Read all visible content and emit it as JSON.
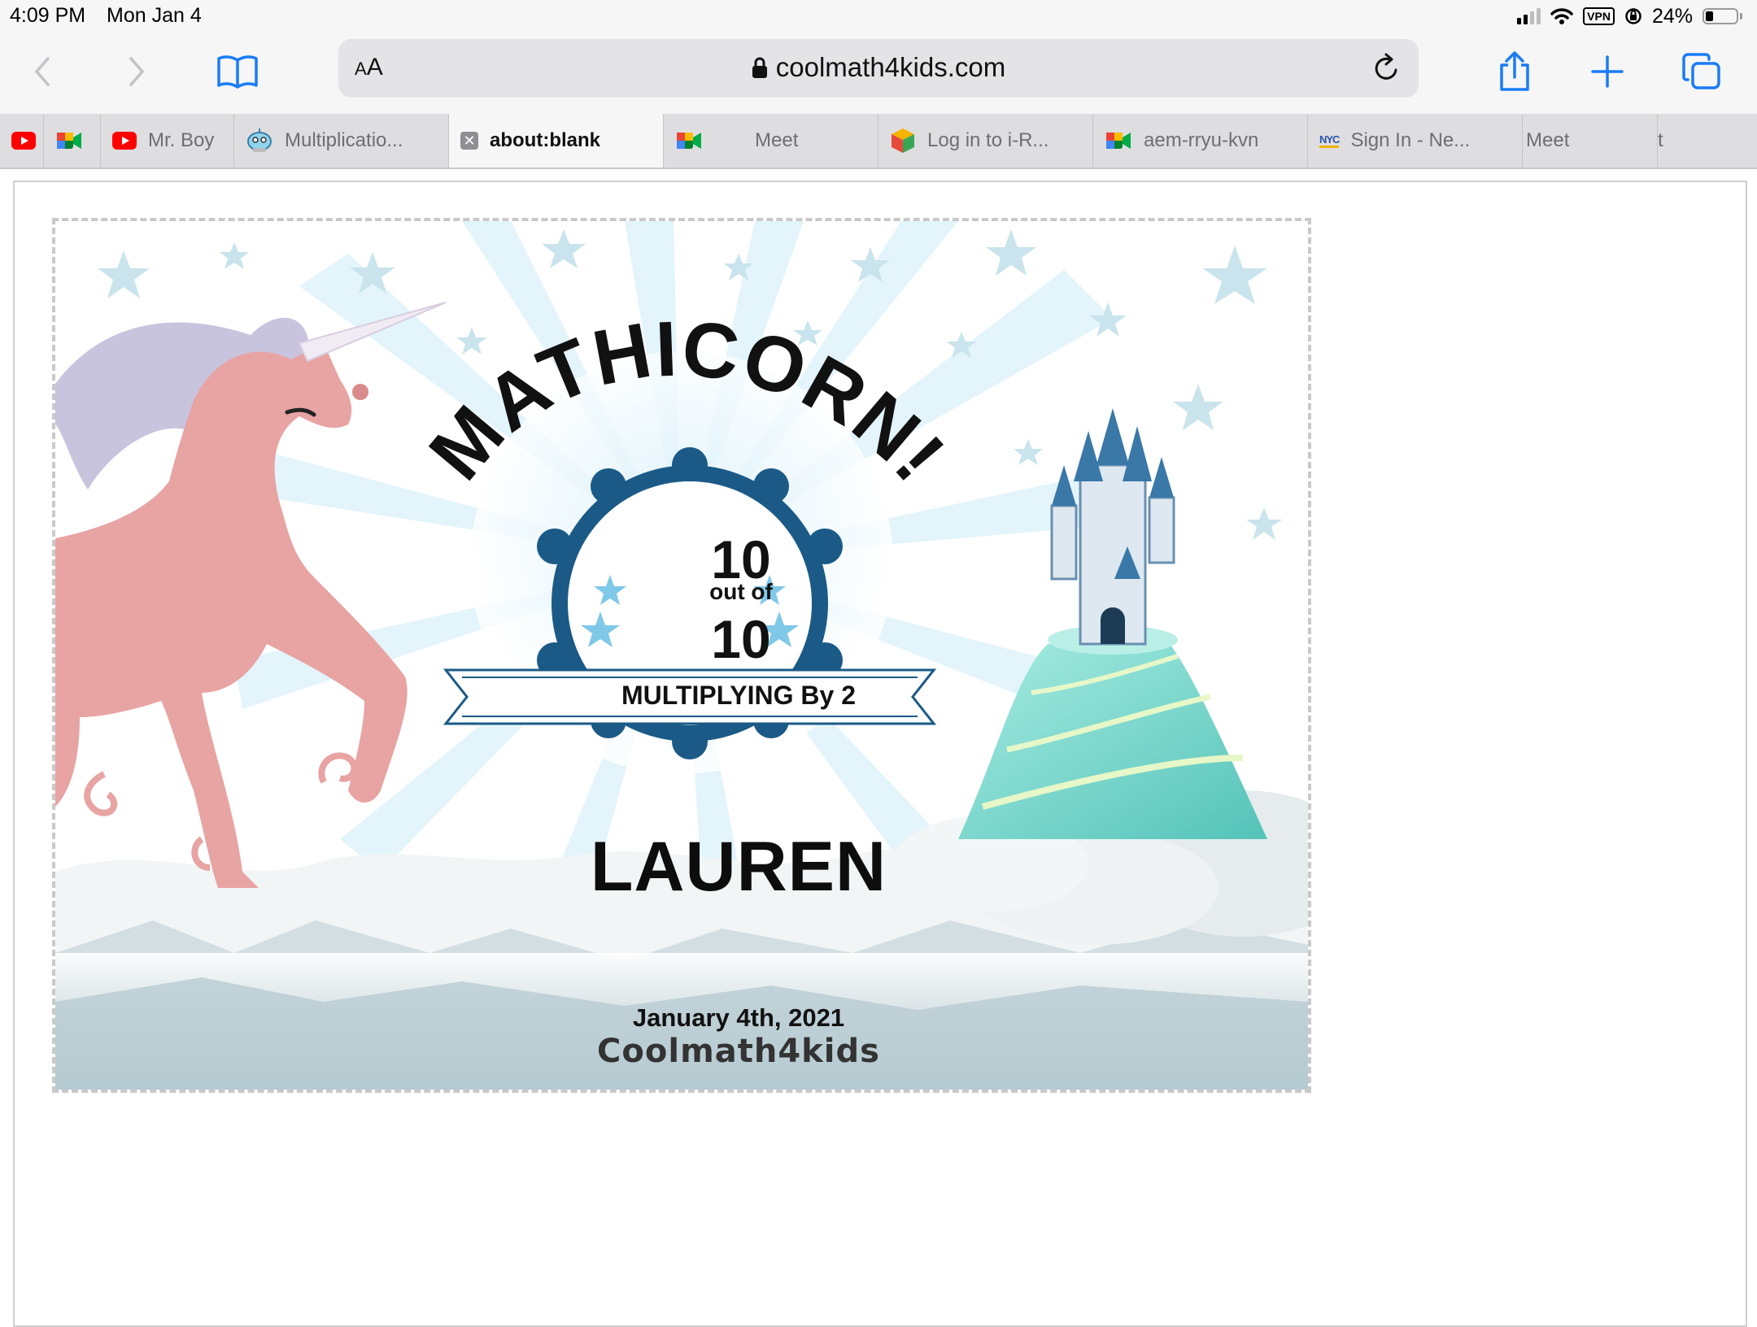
{
  "status_bar": {
    "time": "4:09 PM",
    "date": "Mon Jan 4",
    "vpn_label": "VPN",
    "battery_percent": "24%",
    "battery_level": 0.24
  },
  "toolbar": {
    "reader_label": "AA",
    "url": "coolmath4kids.com"
  },
  "tabs": [
    {
      "icon": "youtube-icon",
      "title": ""
    },
    {
      "icon": "google-meet-icon",
      "title": ""
    },
    {
      "icon": "youtube-icon",
      "title": "Mr. Boy"
    },
    {
      "icon": "robot-icon",
      "title": "Multiplicatio..."
    },
    {
      "icon": "close-tab-icon",
      "title": "about:blank",
      "active": true
    },
    {
      "icon": "google-meet-icon",
      "title": "Meet"
    },
    {
      "icon": "cube-icon",
      "title": "Log in to i-R..."
    },
    {
      "icon": "google-meet-icon",
      "title": "aem-rryu-kvn"
    },
    {
      "icon": "nyc-icon",
      "title": "Sign In - Ne..."
    },
    {
      "icon": "",
      "title": "Meet"
    },
    {
      "icon": "",
      "title": "t"
    }
  ],
  "certificate": {
    "title": "MATHICORN!",
    "score": "10",
    "out_of_label": "out of",
    "total": "10",
    "skill": "MULTIPLYING By 2",
    "student_name": "LAUREN",
    "date": "January 4th, 2021",
    "brand": "Coolmath4kids",
    "colors": {
      "badge_blue": "#1b5a86",
      "star_blue": "#7fc8e8",
      "unicorn_pink": "#e8a3a3",
      "mane_lavender": "#c9c4de",
      "hill_teal": "#7fd9cf"
    }
  }
}
